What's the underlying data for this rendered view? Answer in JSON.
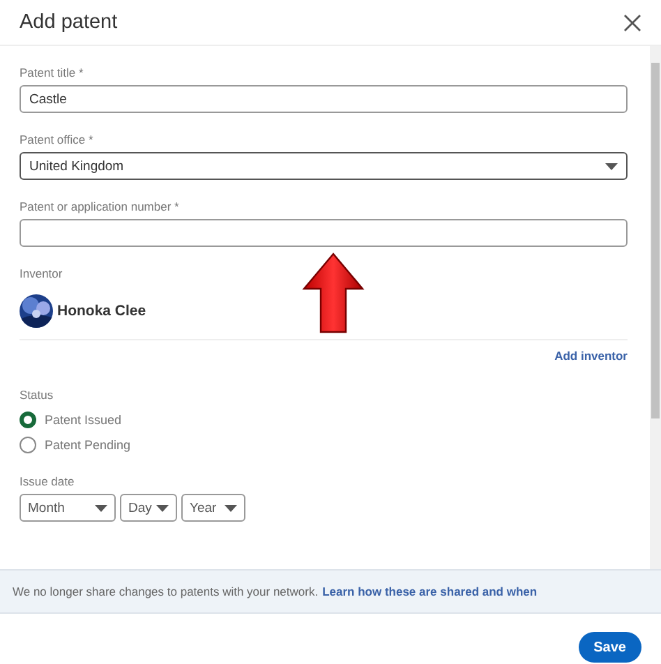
{
  "dialog": {
    "title": "Add patent"
  },
  "fields": [
    {
      "kind": "text",
      "label": "Patent title *",
      "value": "Castle"
    },
    {
      "kind": "select",
      "label": "Patent office *",
      "value": "United Kingdom"
    },
    {
      "kind": "text",
      "label": "Patent or application number *"
    }
  ],
  "inventor": {
    "label": "Inventor",
    "name": "Honoka Clee",
    "add_link": "Add inventor"
  },
  "status": {
    "label": "Status",
    "options": [
      {
        "label": "Patent Issued",
        "selected": true
      },
      {
        "label": "Patent Pending",
        "selected": false
      }
    ]
  },
  "issue_date": {
    "label": "Issue date",
    "selects": [
      "Month",
      "Day",
      "Year"
    ]
  },
  "notice": {
    "text": "We no longer share changes to patents with your network.",
    "link": "Learn how these are shared and when"
  },
  "buttons": [
    "Save"
  ]
}
